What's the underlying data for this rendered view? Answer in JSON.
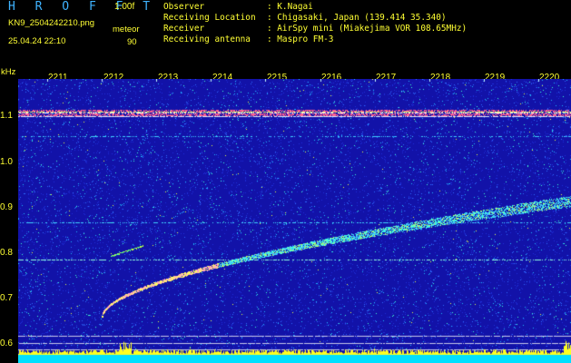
{
  "header": {
    "app_title": "H R O F F T",
    "version": "1.00f",
    "file_name": "KN9_2504242210.png",
    "timestamp": "25.04.24 22:10",
    "meteor_label": "meteor",
    "meteor_count": "90"
  },
  "info": [
    {
      "key": "Observer",
      "value": ": K.Nagai"
    },
    {
      "key": "Receiving Location",
      "value": ": Chigasaki, Japan (139.414 35.340)"
    },
    {
      "key": "Receiver",
      "value": ": AirSpy mini (Miakejima VOR 108.65MHz)"
    },
    {
      "key": "Receiving antenna",
      "value": ": Maspro FM-3"
    }
  ],
  "axis": {
    "y_unit": "kHz",
    "y_ticks": [
      "1.1",
      "1.0",
      "0.9",
      "0.8",
      "0.7",
      "0.6"
    ],
    "x_ticks": [
      "2211",
      "2212",
      "2213",
      "2214",
      "2215",
      "2216",
      "2217",
      "2218",
      "2219",
      "2220"
    ]
  },
  "colors": {
    "background": "#1212a8",
    "label": "#ffff33",
    "title": "#3fb3ff",
    "noise_band": "#00e0ff"
  }
}
